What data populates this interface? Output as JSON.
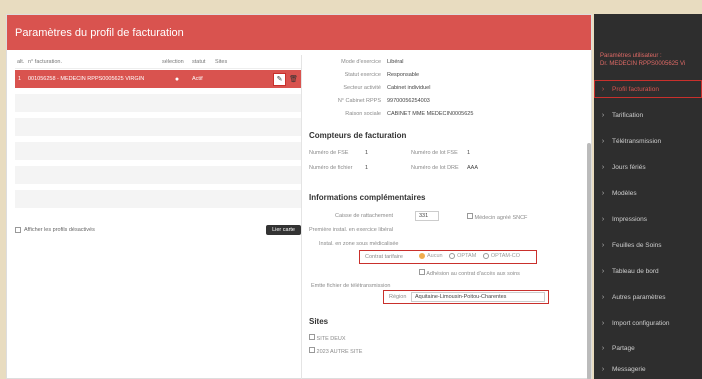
{
  "window": {
    "title": "Paramètres du profil de facturation"
  },
  "table": {
    "headers": {
      "alt": "alt.",
      "num": "n° facturation.",
      "sel": "sélection",
      "stat": "statut",
      "sites": "Sites"
    },
    "rows": [
      {
        "alt": "1",
        "num": "001056258 - MEDECIN RPPS0005625 VIRGIN",
        "sel": "●",
        "stat": "Actif"
      }
    ]
  },
  "left_footer": {
    "show_disabled": "Afficher les profils désactivés",
    "button": "Lier carte"
  },
  "details": {
    "mode_exercice": {
      "label": "Mode d'exercice",
      "value": "Libéral"
    },
    "statut_exercice": {
      "label": "Statut exercice",
      "value": "Responsable"
    },
    "secteur": {
      "label": "Secteur activité",
      "value": "Cabinet individuel"
    },
    "cabinet": {
      "label": "N° Cabinet RPPS",
      "value": "99700056254003"
    },
    "raison": {
      "label": "Raison sociale",
      "value": "CABINET MME MEDECIN0005625"
    }
  },
  "compteurs": {
    "title": "Compteurs de facturation",
    "num_fse": {
      "label": "Numéro de FSE",
      "value": "1"
    },
    "num_lot_fse": {
      "label": "Numéro de lot FSE",
      "value": "1"
    },
    "num_fichier": {
      "label": "Numéro de fichier",
      "value": "1"
    },
    "num_lot_dre": {
      "label": "Numéro de lot DRE",
      "value": "AAA"
    }
  },
  "infos": {
    "title": "Informations complémentaires",
    "caisse": {
      "label": "Caisse de rattachement",
      "value": "331"
    },
    "agree_sncf": "Médecin agréé SNCF",
    "premiere_instal": "Première instal. en exercice libéral",
    "instal_zone": "Instal. en zone sous médicalisée",
    "contrat": {
      "label": "Contrat tarifaire",
      "options": [
        "Aucun",
        "OPTAM",
        "OPTAM-CO"
      ]
    },
    "adhesion": "Adhésion au contrat d'accès aux soins",
    "emetteur": "Emtte fichier de télétransmission",
    "region": {
      "label": "Région",
      "value": "Aquitaine-Limousin-Poitou-Charentes"
    }
  },
  "sites": {
    "title": "Sites",
    "items": [
      "SITE DEUX",
      "2023 AUTRE SITE"
    ]
  },
  "sidebar": {
    "header_line1": "Paramètres utilisateur :",
    "header_line2": "Dr. MEDECIN RPPS0005625 Vi",
    "items": [
      "Profil facturation",
      "Tarification",
      "Télétransmission",
      "Jours fériés",
      "Modèles",
      "Impressions",
      "Feuilles de Soins",
      "Tableau de bord",
      "Autres paramètres",
      "Import configuration",
      "Partage",
      "Messagerie"
    ]
  },
  "colors": {
    "accent": "#d9534f",
    "highlight_box": "#c9302c",
    "sidebar_bg": "#2e2e2e",
    "background": "#e8dcc0"
  }
}
